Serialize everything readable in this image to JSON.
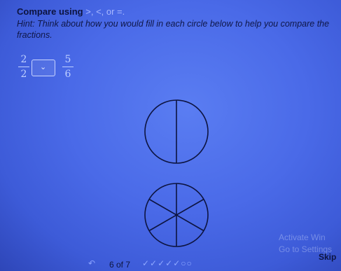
{
  "question": {
    "title_prefix": "Compare using",
    "symbols": ">, <, or =.",
    "hint": "Hint: Think about how you would fill in each circle below to help you compare the fractions."
  },
  "comparison": {
    "left_numerator": "2",
    "left_denominator": "2",
    "right_numerator": "5",
    "right_denominator": "6",
    "dropdown_value": ""
  },
  "circles": [
    {
      "name": "halves",
      "parts": 2
    },
    {
      "name": "sixths",
      "parts": 6
    }
  ],
  "watermark": {
    "line1": "Activate Win",
    "line2": "Go to Settings"
  },
  "footer": {
    "page_count": "6 of 7",
    "progress_marks": "✓✓✓✓✓○○",
    "skip_label": "Skip"
  },
  "icons": {
    "dropdown": "chevron-down-icon",
    "back": "back-arrow-icon"
  }
}
